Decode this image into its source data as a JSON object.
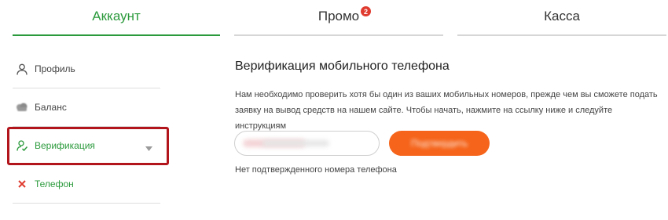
{
  "tabs": [
    {
      "label": "Аккаунт",
      "active": true
    },
    {
      "label": "Промо",
      "badge": "2"
    },
    {
      "label": "Касса"
    }
  ],
  "sidebar": {
    "items": [
      {
        "label": "Профиль",
        "icon": "user-icon"
      },
      {
        "label": "Баланс",
        "icon": "wallet-icon"
      },
      {
        "label": "Верификация",
        "icon": "user-check-icon"
      },
      {
        "label": "Телефон",
        "icon": "close-icon"
      }
    ]
  },
  "main": {
    "title": "Верификация мобильного телефона",
    "description": "Нам необходимо проверить хотя бы один из ваших мобильных номеров, прежде чем вы сможете подать заявку на вывод средств на нашем сайте. Чтобы начать, нажмите на ссылку ниже и следуйте инструкциям",
    "confirm_label": "Подтвердить",
    "status": "Нет подтвержденного номера телефона"
  },
  "colors": {
    "accent": "#2b9a3c",
    "button": "#f5641a",
    "badge": "#e03b2f",
    "highlight": "#b3151c"
  }
}
